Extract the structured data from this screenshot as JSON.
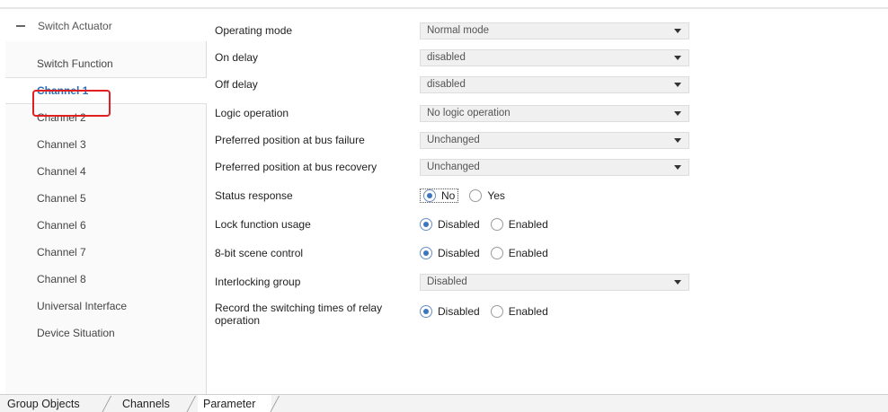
{
  "sidebar": {
    "header_label": "Switch Actuator",
    "items": [
      {
        "label": "Switch Function",
        "selected": false
      },
      {
        "label": "Channel 1",
        "selected": true
      },
      {
        "label": "Channel 2",
        "selected": false
      },
      {
        "label": "Channel 3",
        "selected": false
      },
      {
        "label": "Channel 4",
        "selected": false
      },
      {
        "label": "Channel 5",
        "selected": false
      },
      {
        "label": "Channel 6",
        "selected": false
      },
      {
        "label": "Channel 7",
        "selected": false
      },
      {
        "label": "Channel 8",
        "selected": false
      },
      {
        "label": "Universal Interface",
        "selected": false
      },
      {
        "label": "Device Situation",
        "selected": false
      }
    ]
  },
  "params": {
    "operating_mode": {
      "label": "Operating mode",
      "value": "Normal mode"
    },
    "on_delay": {
      "label": "On delay",
      "value": "disabled"
    },
    "off_delay": {
      "label": "Off delay",
      "value": "disabled"
    },
    "logic_operation": {
      "label": "Logic operation",
      "value": "No logic operation"
    },
    "bus_failure": {
      "label": "Preferred position at bus failure",
      "value": "Unchanged"
    },
    "bus_recovery": {
      "label": "Preferred position at bus recovery",
      "value": "Unchanged"
    },
    "status_response": {
      "label": "Status response",
      "options": [
        "No",
        "Yes"
      ],
      "selected": "No"
    },
    "lock_function": {
      "label": "Lock function usage",
      "options": [
        "Disabled",
        "Enabled"
      ],
      "selected": "Disabled"
    },
    "scene_control": {
      "label": "8-bit scene control",
      "options": [
        "Disabled",
        "Enabled"
      ],
      "selected": "Disabled"
    },
    "interlocking_group": {
      "label": "Interlocking group",
      "value": "Disabled"
    },
    "record_switching": {
      "label_line1": "Record the switching times of relay",
      "label_line2": "operation",
      "options": [
        "Disabled",
        "Enabled"
      ],
      "selected": "Disabled"
    }
  },
  "tabs": {
    "group_objects": "Group Objects",
    "channels": "Channels",
    "parameter": "Parameter",
    "active": "Parameter"
  },
  "colors": {
    "highlight_border": "#e02020",
    "selected_text": "#2a6fb5",
    "radio_dot": "#3a76c0"
  }
}
